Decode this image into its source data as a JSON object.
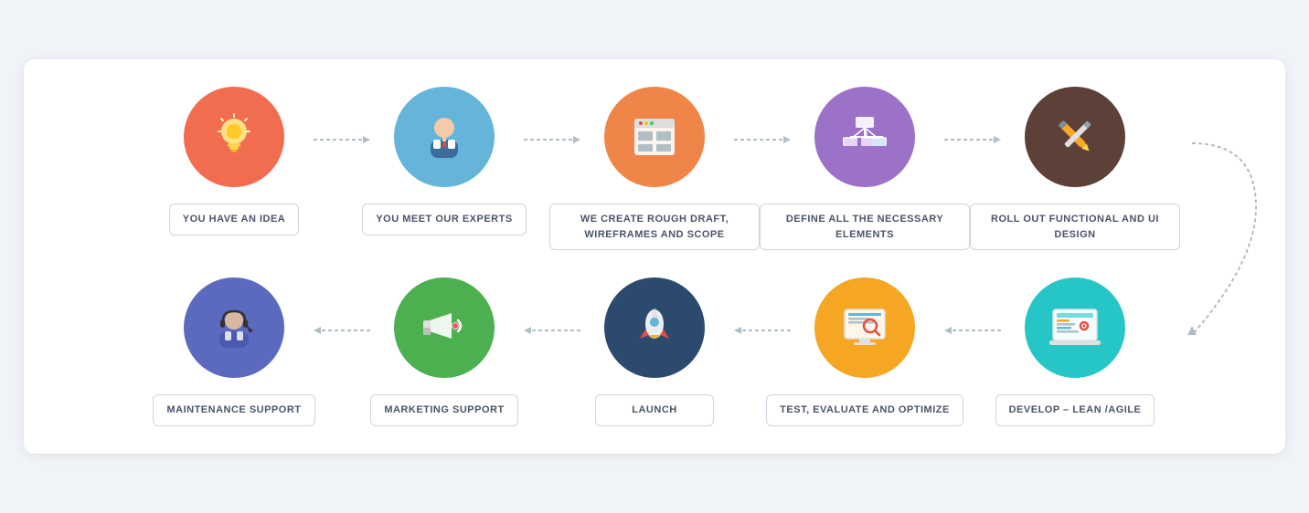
{
  "steps_row1": [
    {
      "id": "idea",
      "label": "YOU HAVE AN IDEA",
      "bg": "#f26c4f",
      "icon": "bulb",
      "icon_char": "💡"
    },
    {
      "id": "experts",
      "label": "YOU MEET OUR EXPERTS",
      "bg": "#64b5d9",
      "icon": "person",
      "icon_char": "👤"
    },
    {
      "id": "draft",
      "label": "WE CREATE ROUGH DRAFT, WIREFRAMES AND SCOPE",
      "bg": "#f0854a",
      "icon": "wireframe",
      "icon_char": "🗂"
    },
    {
      "id": "elements",
      "label": "DEFINE ALL THE NECESSARY ELEMENTS",
      "bg": "#9b72c8",
      "icon": "elements",
      "icon_char": "📊"
    },
    {
      "id": "design",
      "label": "ROLL OUT FUNCTIONAL AND UI DESIGN",
      "bg": "#5d4037",
      "icon": "design",
      "icon_char": "✏️"
    }
  ],
  "steps_row2": [
    {
      "id": "support",
      "label": "MAINTENANCE SUPPORT",
      "bg": "#5b6abf",
      "icon": "support",
      "icon_char": "🎧"
    },
    {
      "id": "marketing",
      "label": "MARKETING SUPPORT",
      "bg": "#4caf50",
      "icon": "marketing",
      "icon_char": "📣"
    },
    {
      "id": "launch",
      "label": "LAUNCH",
      "bg": "#2c4a6e",
      "icon": "launch",
      "icon_char": "🚀"
    },
    {
      "id": "test",
      "label": "TEST, EVALUATE AND OPTIMIZE",
      "bg": "#f5a623",
      "icon": "test",
      "icon_char": "🔍"
    },
    {
      "id": "develop",
      "label": "DEVELOP – LEAN /AGILE",
      "bg": "#26c6c6",
      "icon": "develop",
      "icon_char": "💻"
    }
  ],
  "colors": {
    "arrow": "#b0bec5",
    "label_border": "#cdd6e0",
    "label_text": "#4a5568"
  }
}
